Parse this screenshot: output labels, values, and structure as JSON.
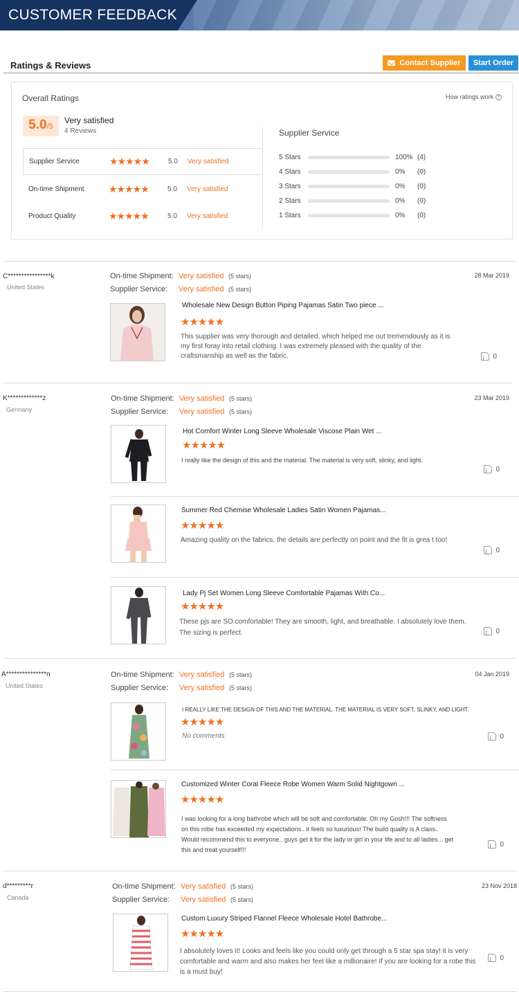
{
  "banner": {
    "title": "CUSTOMER FEEDBACK"
  },
  "header": {
    "title": "Ratings & Reviews",
    "contact_label": "Contact Supplier",
    "start_label": "Start Order"
  },
  "overview": {
    "title": "Overall Ratings",
    "how": "How ratings work",
    "score": "5.0",
    "score_max": "/5",
    "verdict": "Very satisfied",
    "reviews": "4 Reviews",
    "categories": [
      {
        "label": "Supplier Service",
        "stars": 5,
        "score": "5.0",
        "text": "Very satisfied"
      },
      {
        "label": "On-time Shipment",
        "stars": 5,
        "score": "5.0",
        "text": "Very satisfied"
      },
      {
        "label": "Product Quality",
        "stars": 5,
        "score": "5.0",
        "text": "Very satisfied"
      }
    ],
    "supplier_service": {
      "title": "Supplier Service",
      "rows": [
        {
          "label": "5 Stars",
          "fraction": 1.0,
          "pct": "100%",
          "count": "(4)"
        },
        {
          "label": "4 Stars",
          "fraction": 0,
          "pct": "0%",
          "count": "(0)"
        },
        {
          "label": "3 Stars",
          "fraction": 0,
          "pct": "0%",
          "count": "(0)"
        },
        {
          "label": "2 Stars",
          "fraction": 0,
          "pct": "0%",
          "count": "(0)"
        },
        {
          "label": "1 Stars",
          "fraction": 0,
          "pct": "0%",
          "count": "(0)"
        }
      ]
    }
  },
  "star_glyph": "★★★★★",
  "meta_labels": {
    "shipment": "On-time Shipment:",
    "service": "Supplier Service:",
    "satisfied": "Very satisfied",
    "stars": "(5 stars)"
  },
  "reviews": [
    {
      "name": "C****************k",
      "country": "United States",
      "date": "28 Mar 2019",
      "products": [
        {
          "name": "Wholesale New  Design Button Piping Pajamas Satin Two piece ...",
          "text": "This supplier was very thorough and detailed, which helped me out tremendously as it is my first foray into retail clothing.  I was extremely pleased with the quality of the craftsmanship as well as the fabric.",
          "likes": "0"
        }
      ]
    },
    {
      "name": "K*************z",
      "country": "Germany",
      "date": "23 Mar 2019",
      "products": [
        {
          "name": "Hot Comfort Winter Long Sleeve Wholesale Viscose Plain Wet ...",
          "text": "I really like the design of this and the material. The material is very soft, slinky, and light.",
          "likes": "0"
        },
        {
          "name": "Summer Red Chemise Wholesale Ladies Satin Women Pajamas...",
          "text": "Amazing quality on the fabrics, the details are perfectly on point and the fit is grea t too!",
          "likes": "0"
        },
        {
          "name": "Lady Pj Set Women Long Sleeve Comfortable Pajamas With Co...",
          "text": "These pjs are SO comfortable! They are smooth, light, and breathable. I absolutely love them. The sizing is perfect.",
          "likes": "0"
        }
      ]
    },
    {
      "name": "A***************n",
      "country": "United States",
      "date": "04 Jan 2019",
      "products": [
        {
          "name": "I REALLY LIKE THE DESIGN OF THIS AND THE MATERIAL. THE MATERIAL IS VERY SOFT, SLINKY, AND LIGHT.",
          "text": "No comments",
          "likes": "0"
        },
        {
          "name": "Customized Winter Coral Fleece Robe Women Warm Solid Nightgown ...",
          "text": "I was looking for a long bathrobe which will be soft and comfortable. Oh my Gosh!!! The softness on this robe has exceeded my expectations.. it feels so luxurious! The build quality is A class.. Would recommend this to everyone.. guys get it for the lady or girl in your life and to all ladies... get this and treat yourself!!!",
          "likes": "0"
        }
      ]
    },
    {
      "name": "d*********r",
      "country": "Canada",
      "date": "23 Nov 2018",
      "products": [
        {
          "name": "Custom Luxury Striped Flannel Fleece Wholesale Hotel Bathrobe...",
          "text": "I absolutely loves it! Looks and feels like you could only get through a 5 star spa stay! it is very comfortable and warm and also makes her feel like a millionaire! If you are looking for a robe this is a must buy!",
          "likes": "0"
        }
      ]
    }
  ]
}
